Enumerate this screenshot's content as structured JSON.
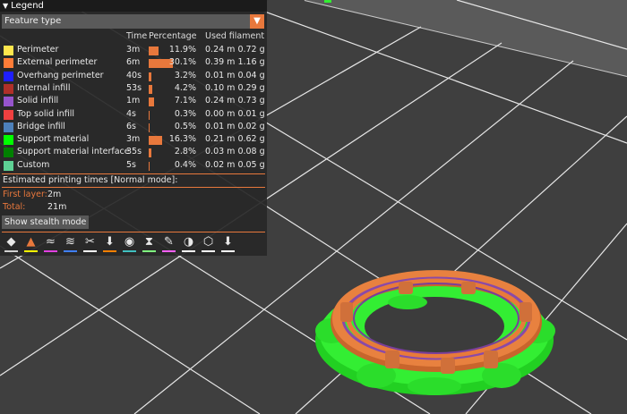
{
  "legend": {
    "title": "Legend",
    "view_type": "Feature type",
    "headers": {
      "time": "Time",
      "percentage": "Percentage",
      "used_filament": "Used filament"
    },
    "rows": [
      {
        "name": "Perimeter",
        "color": "#ffe64d",
        "time": "3m",
        "pct_value": 11.9,
        "pct": "11.9%",
        "filament": "0.24 m  0.72 g"
      },
      {
        "name": "External perimeter",
        "color": "#ff7d38",
        "time": "6m",
        "pct_value": 30.1,
        "pct": "30.1%",
        "filament": "0.39 m  1.16 g"
      },
      {
        "name": "Overhang perimeter",
        "color": "#1f1fff",
        "time": "40s",
        "pct_value": 3.2,
        "pct": "3.2%",
        "filament": "0.01 m  0.04 g"
      },
      {
        "name": "Internal infill",
        "color": "#b03029",
        "time": "53s",
        "pct_value": 4.2,
        "pct": "4.2%",
        "filament": "0.10 m  0.29 g"
      },
      {
        "name": "Solid infill",
        "color": "#9654cc",
        "time": "1m",
        "pct_value": 7.1,
        "pct": "7.1%",
        "filament": "0.24 m  0.73 g"
      },
      {
        "name": "Top solid infill",
        "color": "#f04040",
        "time": "4s",
        "pct_value": 0.3,
        "pct": "0.3%",
        "filament": "0.00 m  0.01 g"
      },
      {
        "name": "Bridge infill",
        "color": "#4d80ba",
        "time": "6s",
        "pct_value": 0.5,
        "pct": "0.5%",
        "filament": "0.01 m  0.02 g"
      },
      {
        "name": "Support material",
        "color": "#00ff00",
        "time": "3m",
        "pct_value": 16.3,
        "pct": "16.3%",
        "filament": "0.21 m  0.62 g"
      },
      {
        "name": "Support material interface",
        "color": "#008000",
        "time": "35s",
        "pct_value": 2.8,
        "pct": "2.8%",
        "filament": "0.03 m  0.08 g"
      },
      {
        "name": "Custom",
        "color": "#5ed194",
        "time": "5s",
        "pct_value": 0.4,
        "pct": "0.4%",
        "filament": "0.02 m  0.05 g"
      }
    ],
    "estimated_title": "Estimated printing times [Normal mode]:",
    "first_layer_label": "First layer:",
    "first_layer_value": "2m",
    "total_label": "Total:",
    "total_value": "21m",
    "stealth_button": "Show stealth mode",
    "toolbar_icons": [
      {
        "name": "travel-icon",
        "color": "#d0d0d0"
      },
      {
        "name": "wipe-icon",
        "color": "#ffff00"
      },
      {
        "name": "retractions-icon",
        "color": "#e040e0"
      },
      {
        "name": "deretractions-icon",
        "color": "#4080ff"
      },
      {
        "name": "seams-icon",
        "color": "#ffffff"
      },
      {
        "name": "tool-changes-icon",
        "color": "#ff8000"
      },
      {
        "name": "color-changes-icon",
        "color": "#40c0c0"
      },
      {
        "name": "pause-prints-icon",
        "color": "#80ff80"
      },
      {
        "name": "custom-gcodes-icon",
        "color": "#ff60ff"
      },
      {
        "name": "center-of-gravity-icon",
        "color": "#ffffff"
      },
      {
        "name": "shells-icon",
        "color": "#ffffff"
      },
      {
        "name": "tool-marker-icon",
        "color": "#ffffff"
      }
    ]
  }
}
